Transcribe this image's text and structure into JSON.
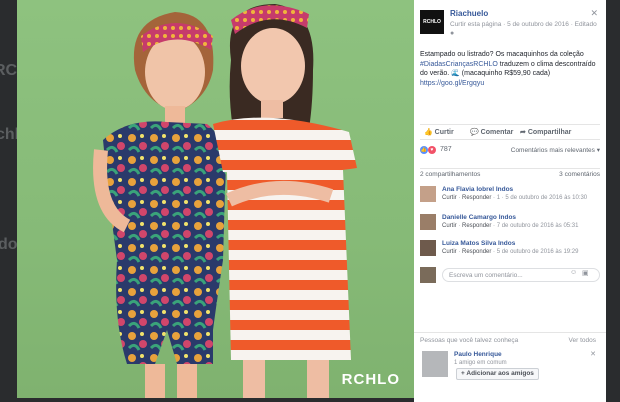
{
  "backdrop": {
    "ghost_1": "RC",
    "ghost_2": "chlo",
    "ghost_3": "dos"
  },
  "photo": {
    "watermark": "RCHLO"
  },
  "header": {
    "logo": "RCHLO",
    "page_name": "Riachuelo",
    "meta": "Curtir esta página · 5 de outubro de 2016 · Editado",
    "globe_icon": "globe-icon",
    "close": "✕"
  },
  "post": {
    "text1": "Estampado ou listrado? Os macaquinhos da coleção",
    "hashtag": "#DiadasCriançasRCHLO",
    "text2": " traduzem o clima descontraído do verão. 🌊 (macaquinho R$59,90 cada) ",
    "link": "https://goo.gl/Ergqyu"
  },
  "actions": {
    "like": "Curtir",
    "comment": "Comentar",
    "share": "Compartilhar"
  },
  "reactions": {
    "count": "787",
    "relevance": "Comentários mais relevantes ▾",
    "like_color": "#5890ff",
    "love_color": "#f25268"
  },
  "stats": {
    "shares": "2 compartilhamentos",
    "comments": "3 comentários"
  },
  "comments": [
    {
      "name": "Ana Flavia Iobrel Indos",
      "like": "Curtir",
      "reply": "Responder",
      "time": "1 · 5 de outubro de 2016 às 10:30"
    },
    {
      "name": "Danielle Camargo Indos",
      "like": "Curtir",
      "reply": "Responder",
      "time": "7 de outubro de 2016 às 05:31"
    },
    {
      "name": "Luiza Matos Silva Indos",
      "like": "Curtir",
      "reply": "Responder",
      "time": "5 de outubro de 2016 às 19:29"
    }
  ],
  "write": {
    "placeholder": "Escreva um comentário...",
    "emoji_icon": "emoji-icon",
    "camera_icon": "camera-icon"
  },
  "suggest": {
    "title": "Pessoas que você talvez conheça",
    "see_all": "Ver todos",
    "name": "Paulo Henrique",
    "mutual": "1 amigo em comum",
    "button": "Adicionar aos amigos",
    "close": "✕"
  }
}
